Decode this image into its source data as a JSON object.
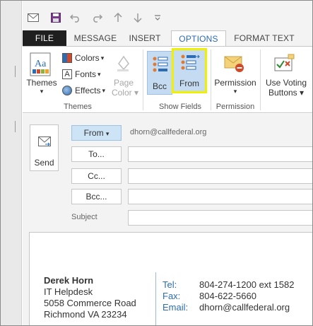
{
  "tabs": {
    "file": "FILE",
    "message": "MESSAGE",
    "insert": "INSERT",
    "options": "OPTIONS",
    "format_text": "FORMAT TEXT"
  },
  "ribbon": {
    "themes_label": "Themes",
    "colors_label": "Colors",
    "fonts_label": "Fonts",
    "effects_label": "Effects",
    "page_color_line1": "Page",
    "page_color_line2": "Color",
    "themes_group": "Themes",
    "bcc_label": "Bcc",
    "from_label": "From",
    "show_fields_group": "Show Fields",
    "permission_label": "Permission",
    "permission_group": "Permission",
    "voting_line1": "Use Voting",
    "voting_line2": "Buttons"
  },
  "compose": {
    "send_label": "Send",
    "from_button": "From",
    "from_value": "dhorn@callfederal.org",
    "to_button": "To...",
    "cc_button": "Cc...",
    "bcc_button": "Bcc...",
    "subject_label": "Subject"
  },
  "signature": {
    "name": "Derek Horn",
    "title": "IT Helpdesk",
    "address1": "5058 Commerce Road",
    "address2": "Richmond VA 23234",
    "tel_label": "Tel:",
    "tel_value": "804-274-1200 ext 1582",
    "fax_label": "Fax:",
    "fax_value": "804-622-5660",
    "email_label": "Email:",
    "email_value": "dhorn@callfederal.org"
  },
  "colors": {
    "accent": "#2b6cb5",
    "highlight": "#f0f000",
    "selected_bg": "#c5dbf2",
    "file_tab_bg": "#1f1f1f"
  },
  "icons": [
    "envelope-icon",
    "save-icon",
    "undo-icon",
    "redo-icon",
    "up-arrow-icon",
    "down-arrow-icon",
    "more-icon",
    "themes-icon",
    "colors-icon",
    "fonts-icon",
    "effects-icon",
    "page-color-icon",
    "bcc-icon",
    "from-icon",
    "permission-icon",
    "voting-icon",
    "send-icon"
  ]
}
